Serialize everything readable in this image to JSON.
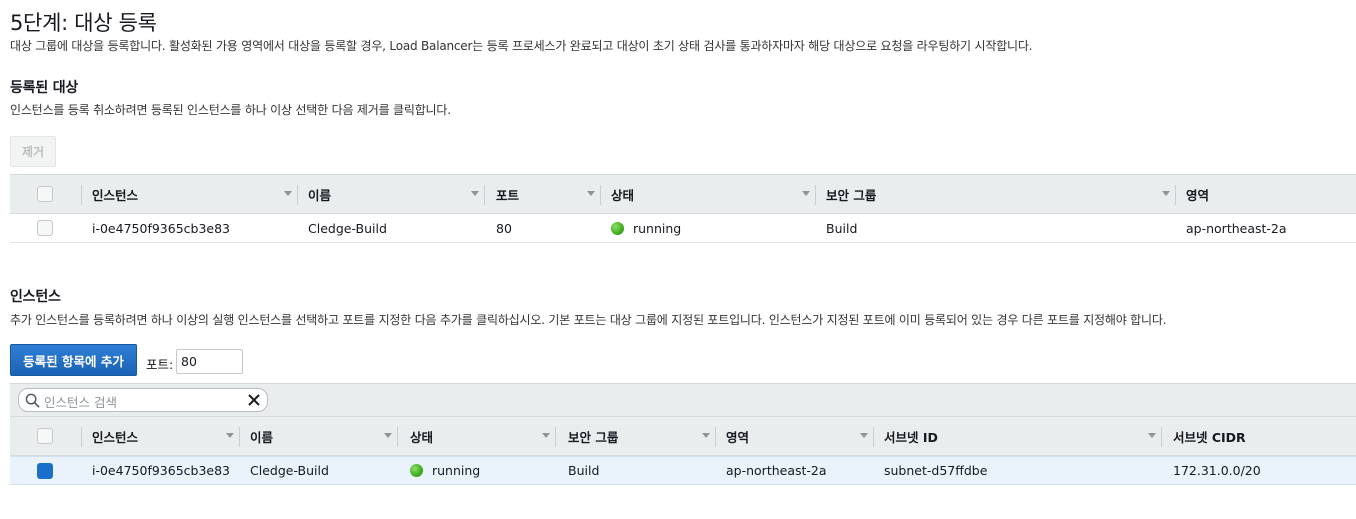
{
  "step": {
    "title": "5단계: 대상 등록",
    "description": "대상 그룹에 대상을 등록합니다. 활성화된 가용 영역에서 대상을 등록할 경우, Load Balancer는 등록 프로세스가 완료되고 대상이 초기 상태 검사를 통과하자마자 해당 대상으로 요청을 라우팅하기 시작합니다."
  },
  "registered": {
    "heading": "등록된 대상",
    "description": "인스턴스를 등록 취소하려면 등록된 인스턴스를 하나 이상 선택한 다음 제거를 클릭합니다.",
    "remove_label": "제거",
    "columns": [
      "인스턴스",
      "이름",
      "포트",
      "상태",
      "보안 그룹",
      "영역"
    ],
    "rows": [
      {
        "instance": "i-0e4750f9365cb3e83",
        "name": "Cledge-Build",
        "port": "80",
        "state": "running",
        "security_group": "Build",
        "zone": "ap-northeast-2a"
      }
    ]
  },
  "instances": {
    "heading": "인스턴스",
    "description": "추가 인스턴스를 등록하려면 하나 이상의 실행 인스턴스를 선택하고 포트를 지정한 다음 추가를 클릭하십시오. 기본 포트는 대상 그룹에 지정된 포트입니다. 인스턴스가 지정된 포트에 이미 등록되어 있는 경우 다른 포트를 지정해야 합니다.",
    "add_label": "등록된 항목에 추가",
    "port_label": "포트:",
    "port_value": "80",
    "search_placeholder": "인스턴스 검색",
    "columns": [
      "인스턴스",
      "이름",
      "상태",
      "보안 그룹",
      "영역",
      "서브넷 ID",
      "서브넷 CIDR"
    ],
    "rows": [
      {
        "instance": "i-0e4750f9365cb3e83",
        "name": "Cledge-Build",
        "state": "running",
        "security_group": "Build",
        "zone": "ap-northeast-2a",
        "subnet_id": "subnet-d57ffdbe",
        "subnet_cidr": "172.31.0.0/20",
        "selected": true
      }
    ]
  },
  "colors": {
    "primary": "#1b62b5",
    "running": "#43b022",
    "header_bg": "#eaeded",
    "selected_row": "#eaf3fb"
  }
}
